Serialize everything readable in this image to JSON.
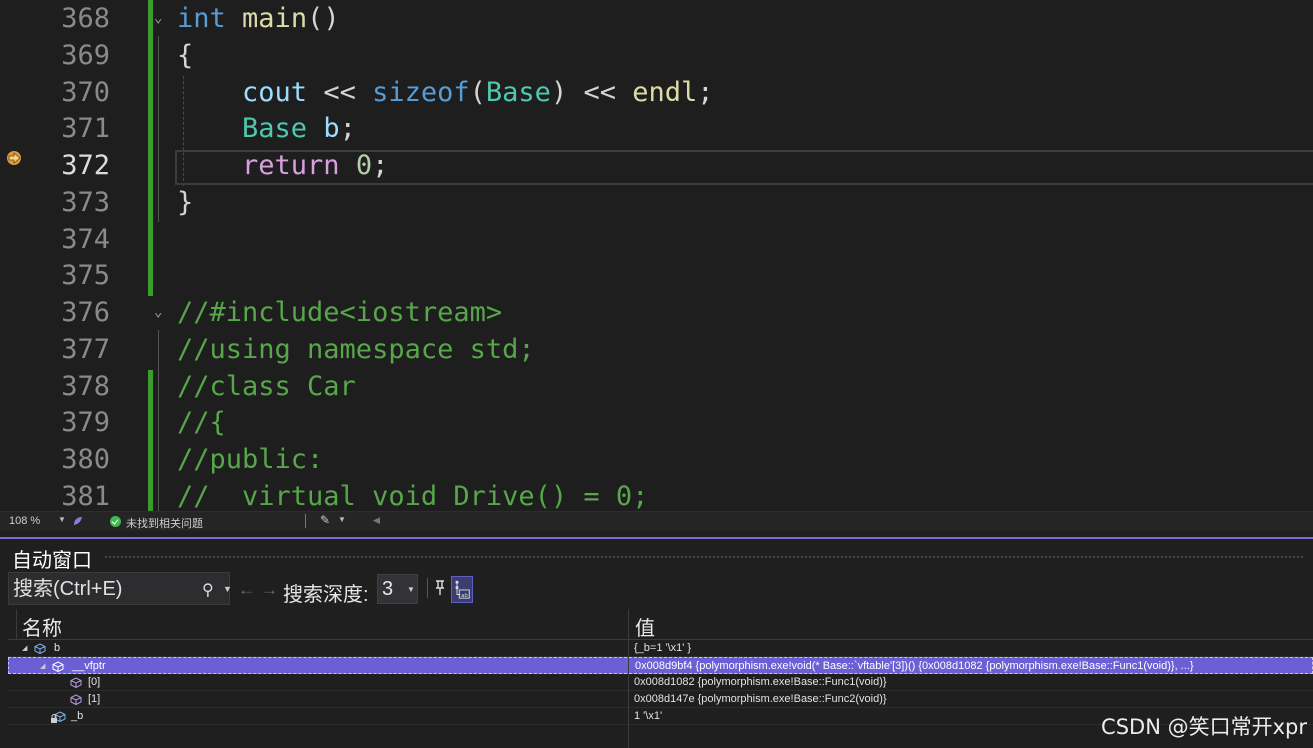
{
  "editor": {
    "lines": [
      {
        "num": "368",
        "tokens": [
          [
            "kw",
            "int"
          ],
          [
            "pl",
            " "
          ],
          [
            "fn",
            "main"
          ],
          [
            "pl",
            "()"
          ]
        ]
      },
      {
        "num": "369",
        "tokens": [
          [
            "pl",
            "{"
          ]
        ]
      },
      {
        "num": "370",
        "tokens": [
          [
            "pl",
            "    "
          ],
          [
            "var",
            "cout"
          ],
          [
            "pl",
            " << "
          ],
          [
            "kw",
            "sizeof"
          ],
          [
            "pl",
            "("
          ],
          [
            "ty",
            "Base"
          ],
          [
            "pl",
            ") << "
          ],
          [
            "fn",
            "endl"
          ],
          [
            "pl",
            ";"
          ]
        ]
      },
      {
        "num": "371",
        "tokens": [
          [
            "pl",
            "    "
          ],
          [
            "ty",
            "Base"
          ],
          [
            "pl",
            " "
          ],
          [
            "var",
            "b"
          ],
          [
            "pl",
            ";"
          ]
        ]
      },
      {
        "num": "372",
        "tokens": [
          [
            "pl",
            "    "
          ],
          [
            "ctl",
            "return"
          ],
          [
            "pl",
            " "
          ],
          [
            "num",
            "0"
          ],
          [
            "pl",
            ";"
          ]
        ]
      },
      {
        "num": "373",
        "tokens": [
          [
            "pl",
            "}"
          ]
        ]
      },
      {
        "num": "374",
        "tokens": []
      },
      {
        "num": "375",
        "tokens": []
      },
      {
        "num": "376",
        "tokens": [
          [
            "cm",
            "//#include<iostream>"
          ]
        ]
      },
      {
        "num": "377",
        "tokens": [
          [
            "cm",
            "//using namespace std;"
          ]
        ]
      },
      {
        "num": "378",
        "tokens": [
          [
            "cm",
            "//class Car"
          ]
        ]
      },
      {
        "num": "379",
        "tokens": [
          [
            "cm",
            "//{"
          ]
        ]
      },
      {
        "num": "380",
        "tokens": [
          [
            "cm",
            "//public:"
          ]
        ]
      },
      {
        "num": "381",
        "tokens": [
          [
            "cm",
            "//  virtual void Drive() = 0;"
          ]
        ]
      }
    ],
    "current_line": "372"
  },
  "status": {
    "zoom": "108 %",
    "issues_text": "未找到相关问题"
  },
  "autos": {
    "title": "自动窗口",
    "search_placeholder": "搜索(Ctrl+E)",
    "depth_label": "搜索深度:",
    "depth_value": "3",
    "col_name": "名称",
    "col_value": "值",
    "rows": [
      {
        "name": "b",
        "value": "{_b=1 '\\x1' }"
      },
      {
        "name": "__vfptr",
        "value": "0x008d9bf4 {polymorphism.exe!void(* Base::`vftable'[3])() {0x008d1082 {polymorphism.exe!Base::Func1(void)}, ...}"
      },
      {
        "name": "[0]",
        "value": "0x008d1082 {polymorphism.exe!Base::Func1(void)}"
      },
      {
        "name": "[1]",
        "value": "0x008d147e {polymorphism.exe!Base::Func2(void)}"
      },
      {
        "name": "_b",
        "value": "1 '\\x1'"
      }
    ]
  },
  "watermark": "CSDN @笑口常开xpr",
  "colors": {
    "keyword": "#569cd6",
    "control": "#d8a0df",
    "function": "#dcdcaa",
    "type": "#4ec9b0",
    "variable": "#9cdcfe",
    "number": "#b5cea8",
    "comment": "#57a64a",
    "selection": "#6b5fd6",
    "accent": "#7b6cd9"
  },
  "icons": {
    "breakpoint_arrow": "current-statement-arrow-icon",
    "search": "search-icon",
    "pin": "pin-icon",
    "hex": "hex-display-icon",
    "variable": "variable-cube-icon",
    "lock": "private-lock-icon"
  }
}
